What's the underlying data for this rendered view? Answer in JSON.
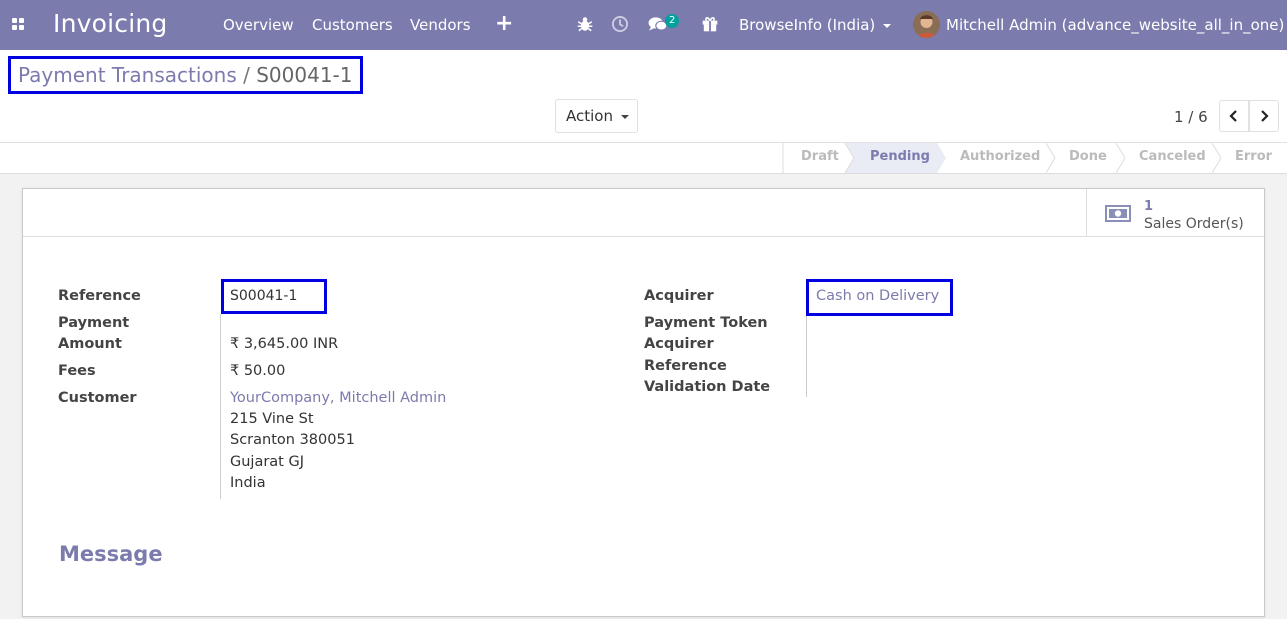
{
  "navbar": {
    "app_title": "Invoicing",
    "menu": [
      "Overview",
      "Customers",
      "Vendors"
    ],
    "chat_badge": "2",
    "company": "BrowseInfo (India)",
    "user": "Mitchell Admin (advance_website_all_in_one)"
  },
  "breadcrumb": {
    "parent": "Payment Transactions",
    "separator": "/",
    "current": "S00041-1"
  },
  "toolbar": {
    "action_label": "Action",
    "pager": "1 / 6"
  },
  "stages": [
    {
      "label": "Draft"
    },
    {
      "label": "Pending"
    },
    {
      "label": "Authorized"
    },
    {
      "label": "Done"
    },
    {
      "label": "Canceled"
    },
    {
      "label": "Error"
    }
  ],
  "smart_button": {
    "count": "1",
    "label": "Sales Order(s)"
  },
  "form": {
    "reference_label": "Reference",
    "reference_value": "S00041-1",
    "payment_label_1": "Payment",
    "payment_label_2": "Amount",
    "amount_value": "₹ 3,645.00 INR",
    "fees_label": "Fees",
    "fees_value": "₹ 50.00",
    "customer_label": "Customer",
    "customer_name": "YourCompany, Mitchell Admin",
    "address": [
      "215 Vine St",
      "Scranton 380051",
      "Gujarat GJ",
      "India"
    ],
    "acquirer_label": "Acquirer",
    "acquirer_value": "Cash on Delivery",
    "token_label": "Payment Token",
    "acq_ref_label_1": "Acquirer",
    "acq_ref_label_2": "Reference",
    "validation_label": "Validation Date"
  },
  "message_title": "Message",
  "colors": {
    "brand": "#7c7bad",
    "highlight": "#0000e0",
    "badge": "#00a09d"
  }
}
